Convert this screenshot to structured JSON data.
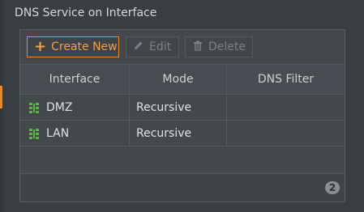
{
  "section": {
    "title": "DNS Service on Interface"
  },
  "toolbar": {
    "create_label": "Create New",
    "edit_label": "Edit",
    "delete_label": "Delete"
  },
  "table": {
    "headers": [
      "Interface",
      "Mode",
      "DNS Filter"
    ],
    "rows": [
      {
        "interface": "DMZ",
        "mode": "Recursive",
        "dns_filter": ""
      },
      {
        "interface": "LAN",
        "mode": "Recursive",
        "dns_filter": ""
      }
    ]
  },
  "footer": {
    "count": "2"
  },
  "colors": {
    "accent": "#e58a2f",
    "icon_green": "#5bb34a"
  }
}
